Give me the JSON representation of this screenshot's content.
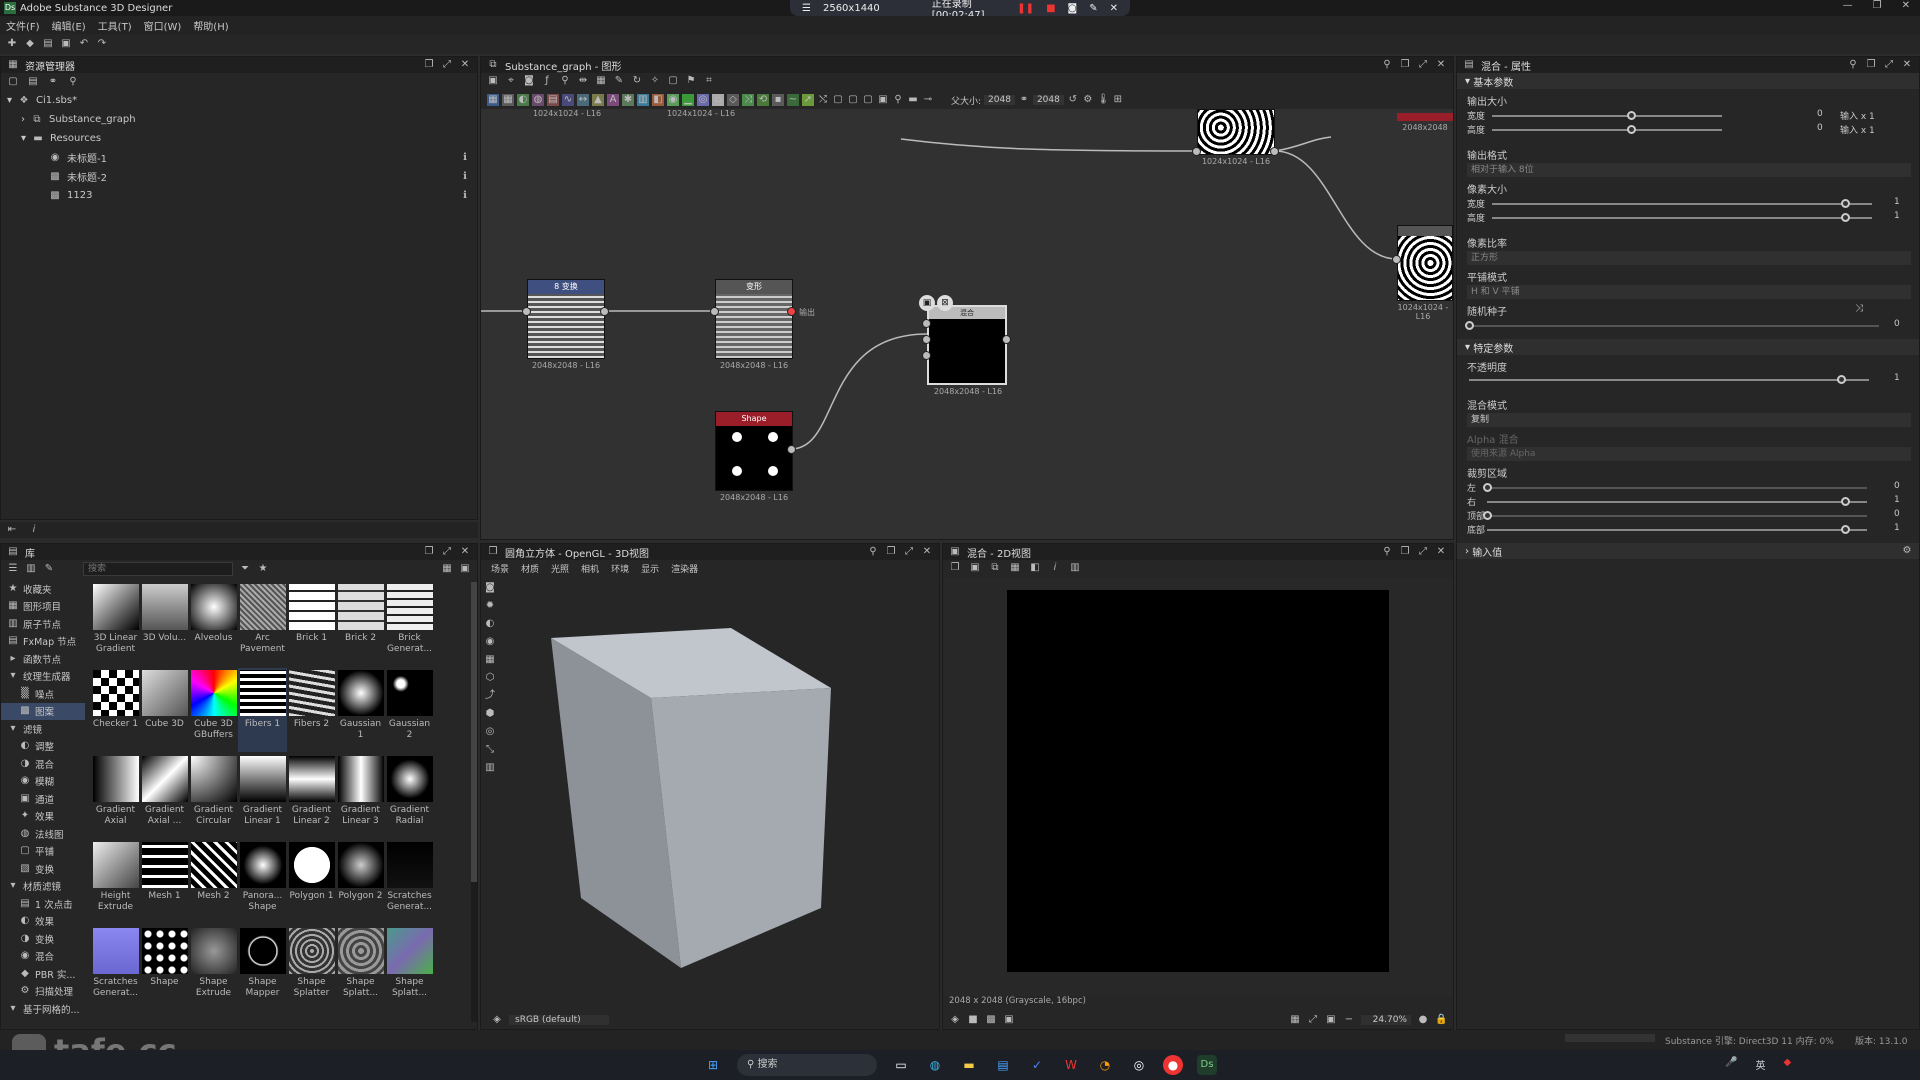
{
  "app": {
    "title": "Adobe Substance 3D Designer"
  },
  "recording": {
    "resolution": "2560x1440",
    "status": "正在录制 [00:02:47]"
  },
  "menu": [
    "文件(F)",
    "编辑(E)",
    "工具(T)",
    "窗口(W)",
    "帮助(H)"
  ],
  "explorer": {
    "title": "资源管理器",
    "items": [
      {
        "label": "Ci1.sbs*",
        "level": 0
      },
      {
        "label": "Substance_graph",
        "level": 1
      },
      {
        "label": "Resources",
        "level": 1
      },
      {
        "label": "未标题-1",
        "level": 2
      },
      {
        "label": "未标题-2",
        "level": 2
      },
      {
        "label": "1123",
        "level": 2
      }
    ]
  },
  "graph": {
    "title": "Substance_graph - 图形",
    "size_label": "父大小:",
    "size_value1": "2048",
    "size_value2": "2048",
    "nodes": [
      {
        "header": "8 变换",
        "label": "2048x2048 - L16"
      },
      {
        "header": "变形",
        "label": "2048x2048 - L16"
      },
      {
        "header": "Shape",
        "label": "2048x2048 - L16"
      },
      {
        "header": "混合",
        "label": "2048x2048 - L16"
      },
      {
        "header": "",
        "label": "1024x1024 - L16"
      },
      {
        "header": "",
        "label": "1024x1024 - L16"
      }
    ],
    "top_labels": [
      "1024x1024 - L16",
      "1024x1024 - L16",
      "2048x2048"
    ],
    "hover_label": "输出"
  },
  "library": {
    "title": "库",
    "search_placeholder": "搜索",
    "categories": [
      "收藏夹",
      "图形项目",
      "原子节点",
      "FxMap 节点",
      "函数节点",
      "纹理生成器",
      "噪点",
      "图案",
      "滤镜",
      "调整",
      "混合",
      "模糊",
      "通道",
      "效果",
      "法线图",
      "平铺",
      "变换",
      "材质滤镜",
      "1 次点击",
      "效果",
      "变换",
      "混合",
      "PBR 实...",
      "扫描处理",
      "基于网格的..."
    ],
    "items": [
      "3D Linear Gradient",
      "3D Volu...",
      "Alveolus",
      "Arc Pavement",
      "Brick 1",
      "Brick 2",
      "Brick Generat...",
      "Checker 1",
      "Cube 3D",
      "Cube 3D GBuffers",
      "Fibers 1",
      "Fibers 2",
      "Gaussian 1",
      "Gaussian 2",
      "Gradient Axial",
      "Gradient Axial ...",
      "Gradient Circular",
      "Gradient Linear 1",
      "Gradient Linear 2",
      "Gradient Linear 3",
      "Gradient Radial",
      "Height Extrude",
      "Mesh 1",
      "Mesh 2",
      "Panora... Shape",
      "Polygon 1",
      "Polygon 2",
      "Scratches Generat...",
      "Scratches Generat...",
      "Shape",
      "Shape Extrude",
      "Shape Mapper",
      "Shape Splatter",
      "Shape Splatt...",
      "Shape Splatt..."
    ]
  },
  "view3d": {
    "title": "圆角立方体 - OpenGL - 3D视图",
    "menu": [
      "场景",
      "材质",
      "光照",
      "相机",
      "环境",
      "显示",
      "渲染器"
    ],
    "colorspace": "sRGB (default)"
  },
  "view2d": {
    "title": "混合 - 2D视图",
    "info": "2048 x 2048 (Grayscale, 16bpc)",
    "zoom": "24.70%"
  },
  "props": {
    "title": "混合 - 属性",
    "sections": [
      "基本参数",
      "特定参数",
      "输入值"
    ],
    "output_size": "输出大小",
    "width": "宽度",
    "height": "高度",
    "w_val": "0",
    "h_val": "0",
    "w_rel": "输入 x 1",
    "h_rel": "输入 x 1",
    "output_format": "输出格式",
    "format_val": "相对于输入 8位",
    "pixel_size": "像素大小",
    "pw": "宽度",
    "ph": "高度",
    "pw_val": "1",
    "ph_val": "1",
    "pixel_ratio": "像素比率",
    "ratio_val": "正方形",
    "tiling": "平铺模式",
    "tiling_val": "H 和 V 平铺",
    "seed": "随机种子",
    "seed_val": "0",
    "opacity": "不透明度",
    "opacity_val": "1",
    "blend_mode": "混合模式",
    "blend_val": "复制",
    "alpha_blend": "Alpha 混合",
    "alpha_val": "使用来源 Alpha",
    "crop": "裁剪区域",
    "left": "左",
    "right": "右",
    "top": "顶部",
    "bottom": "底部",
    "left_val": "0",
    "right_val": "1",
    "top_val": "0",
    "bottom_val": "1"
  },
  "status": {
    "engine": "Substance 引擎: Direct3D 11 内存: 0%",
    "version": "版本: 13.1.0"
  },
  "watermark": "tafe.cc",
  "taskbar": {
    "search": "搜索",
    "ime": "英"
  }
}
